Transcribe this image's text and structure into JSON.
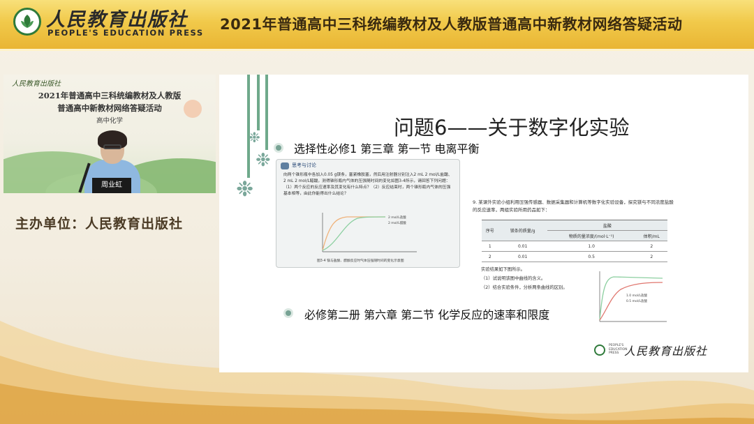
{
  "header": {
    "logo_cn": "人民教育出版社",
    "logo_en": "PEOPLE'S EDUCATION PRESS",
    "event_title": "2021年普通高中三科统编教材及人教版普通高中新教材网络答疑活动"
  },
  "camera": {
    "brand": "人民教育出版社",
    "line1": "2021年普通高中三科统编教材及人教版",
    "line2": "普通高中新教材网络答疑活动",
    "subject": "高中化学",
    "nameplate": "周业虹"
  },
  "organizer": "主办单位：人民教育出版社",
  "slide": {
    "title": "问题6——关于数字化实验",
    "bullet1": "选择性必修1  第三章  第一节  电离平衡",
    "bullet2": "必修第二册  第六章  第二节  化学反应的速率和限度",
    "thumb1": {
      "heading": "思考与讨论",
      "text": "向两个锥形瓶中各加入0.05 g镁条，塞紧橡胶塞，然后用注射器分别注入2 mL 2 mol/L盐酸、2 mL 2 mol/L醋酸，测得锥形瓶内气体的压强随时间的变化如图3-4所示，请回答下列问题：（1）两个反应的反应速率及其变化有什么特点？（2）反应结束时，两个锥形瓶内气体的压强基本相等，由此你能得出什么结论？",
      "legend_a": "2 mol/L盐酸",
      "legend_b": "2 mol/L醋酸",
      "caption": "图3-4  镁与盐酸、醋酸反应时气体压强随时间的变化示意图"
    },
    "thumb2": {
      "question": "9. 某课外实验小组利用压强传感器、数据采集器和计算机等数字化实验设备，探究镁与不同浓度盐酸的反应速率，两组实验所用药品如下：",
      "table_headers": [
        "序号",
        "镁条的质量/g",
        "物质的量浓度/(mol·L⁻¹)",
        "体积/mL"
      ],
      "table_group": "盐酸",
      "rows": [
        [
          "1",
          "0.01",
          "1.0",
          "2"
        ],
        [
          "2",
          "0.01",
          "0.5",
          "2"
        ]
      ],
      "result": "实验结果如下图所示。",
      "q1": "（1）试说明该图中曲线的含义。",
      "q2": "（2）结合实验条件，分析两条曲线的区别。",
      "legend_a": "1.0 mol/L盐酸",
      "legend_b": "0.5 mol/L盐酸"
    },
    "publisher_en": "PEOPLE'S EDUCATION PRESS",
    "publisher_cn": "人民教育出版社"
  },
  "colors": {
    "header_gold": "#f1c94a",
    "accent_green": "#77a294",
    "curve_orange": "#f0b27a",
    "curve_green": "#8ccfa0",
    "curve_red": "#e0766e"
  }
}
